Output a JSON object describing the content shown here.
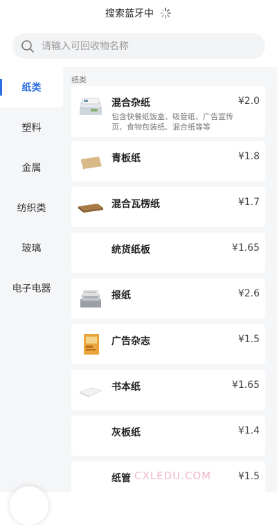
{
  "status": {
    "text": "搜索蓝牙中"
  },
  "search": {
    "placeholder": "请输入可回收物名称"
  },
  "sidebar": {
    "items": [
      {
        "label": "纸类",
        "active": true
      },
      {
        "label": "塑料"
      },
      {
        "label": "金属"
      },
      {
        "label": "纺织类"
      },
      {
        "label": "玻璃"
      },
      {
        "label": "电子电器"
      }
    ]
  },
  "main": {
    "section_title": "纸类",
    "items": [
      {
        "name": "混合杂纸",
        "price": "¥2.0",
        "desc": "包含快餐纸饭盒、吸管纸、广告宣传页、食物包装纸、混合纸等等",
        "icon": "newspaper-stack-icon"
      },
      {
        "name": "青板纸",
        "price": "¥1.8",
        "icon": "cardboard-sheets-icon"
      },
      {
        "name": "混合瓦楞纸",
        "price": "¥1.7",
        "icon": "corrugated-board-icon"
      },
      {
        "name": "统货纸板",
        "price": "¥1.65",
        "icon": ""
      },
      {
        "name": "报纸",
        "price": "¥2.6",
        "icon": "newspaper-icon"
      },
      {
        "name": "广告杂志",
        "price": "¥1.5",
        "icon": "magazine-icon"
      },
      {
        "name": "书本纸",
        "price": "¥1.65",
        "icon": "book-paper-icon"
      },
      {
        "name": "灰板纸",
        "price": "¥1.4",
        "icon": ""
      },
      {
        "name": "纸管",
        "price": "¥1.5",
        "icon": ""
      }
    ]
  },
  "watermark": "CXLEDU.COM",
  "colors": {
    "accent": "#2b6fe0",
    "background": "#f5f6f8"
  }
}
